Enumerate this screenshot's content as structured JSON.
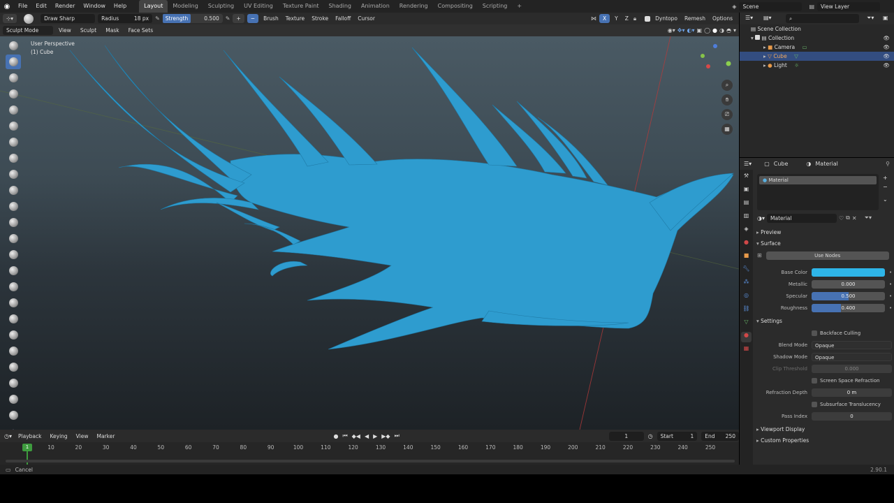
{
  "menubar": {
    "menus": [
      "File",
      "Edit",
      "Render",
      "Window",
      "Help"
    ],
    "workspaces": [
      "Layout",
      "Modeling",
      "Sculpting",
      "UV Editing",
      "Texture Paint",
      "Shading",
      "Animation",
      "Rendering",
      "Compositing",
      "Scripting"
    ],
    "active_workspace": "Layout",
    "scene": "Scene",
    "view_layer": "View Layer"
  },
  "toolheader": {
    "brush_name": "Draw Sharp",
    "radius_label": "Radius",
    "radius_value": "18 px",
    "strength_label": "Strength",
    "strength_value": "0.500",
    "brush_menu": "Brush",
    "texture_menu": "Texture",
    "stroke_menu": "Stroke",
    "falloff_menu": "Falloff",
    "cursor_menu": "Cursor",
    "axis_x": "X",
    "axis_y": "Y",
    "axis_z": "Z",
    "dyntopo": "Dyntopo",
    "remesh": "Remesh",
    "options": "Options"
  },
  "viewport_header": {
    "mode": "Sculpt Mode",
    "view": "View",
    "sculpt": "Sculpt",
    "mask": "Mask",
    "face_sets": "Face Sets"
  },
  "viewport": {
    "perspective": "User Perspective",
    "object": "(1) Cube",
    "mesh_color": "#2e9ccf"
  },
  "outliner": {
    "scene_collection": "Scene Collection",
    "collection": "Collection",
    "items": [
      {
        "label": "Camera",
        "selected": false
      },
      {
        "label": "Cube",
        "selected": true
      },
      {
        "label": "Light",
        "selected": false
      }
    ]
  },
  "properties": {
    "object_name": "Cube",
    "material_tab": "Material",
    "slot": "Material",
    "material_name": "Material",
    "preview": "Preview",
    "surface": "Surface",
    "use_nodes": "Use Nodes",
    "fields": [
      {
        "label": "Base Color",
        "value": "",
        "color": "#2eb5e8"
      },
      {
        "label": "Metallic",
        "value": "0.000",
        "fill": 0
      },
      {
        "label": "Specular",
        "value": "0.500",
        "fill": 0.5
      },
      {
        "label": "Roughness",
        "value": "0.400",
        "fill": 0.4
      }
    ],
    "settings": "Settings",
    "backface_culling": "Backface Culling",
    "blend_mode_label": "Blend Mode",
    "blend_mode": "Opaque",
    "shadow_mode_label": "Shadow Mode",
    "shadow_mode": "Opaque",
    "clip_threshold_label": "Clip Threshold",
    "clip_threshold": "0.000",
    "screen_space_refraction": "Screen Space Refraction",
    "refraction_depth_label": "Refraction Depth",
    "refraction_depth": "0 m",
    "subsurface_translucency": "Subsurface Translucency",
    "pass_index_label": "Pass Index",
    "pass_index": "0",
    "viewport_display": "Viewport Display",
    "custom_properties": "Custom Properties"
  },
  "timeline": {
    "playback": "Playback",
    "keying": "Keying",
    "view": "View",
    "marker": "Marker",
    "current_frame": "1",
    "start_label": "Start",
    "start": "1",
    "end_label": "End",
    "end": "250",
    "ticks": [
      "10",
      "20",
      "30",
      "40",
      "50",
      "60",
      "70",
      "80",
      "90",
      "100",
      "110",
      "120",
      "130",
      "140",
      "150",
      "160",
      "170",
      "180",
      "190",
      "200",
      "210",
      "220",
      "230",
      "240",
      "250"
    ],
    "playhead": "1"
  },
  "statusbar": {
    "left": "Cancel",
    "version": "2.90.1"
  }
}
